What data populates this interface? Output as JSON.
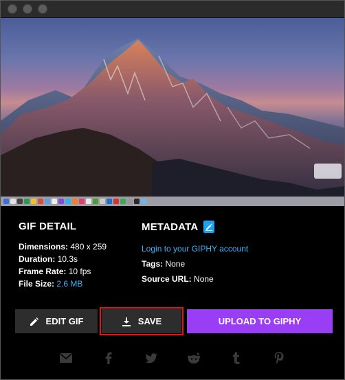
{
  "window": {
    "controls": [
      "close",
      "minimize",
      "zoom"
    ]
  },
  "gif_detail": {
    "title": "GIF DETAIL",
    "dimensions_label": "Dimensions:",
    "dimensions_value": "480 x 259",
    "duration_label": "Duration:",
    "duration_value": "10.3s",
    "frame_rate_label": "Frame Rate:",
    "frame_rate_value": "10 fps",
    "file_size_label": "File Size:",
    "file_size_value": "2.6 MB"
  },
  "metadata": {
    "title": "METADATA",
    "login_link": "Login to your GIPHY account",
    "tags_label": "Tags:",
    "tags_value": "None",
    "source_label": "Source URL:",
    "source_value": "None"
  },
  "buttons": {
    "edit": "EDIT GIF",
    "save": "SAVE",
    "upload": "UPLOAD TO GIPHY"
  },
  "share_icons": [
    "mail-icon",
    "facebook-icon",
    "twitter-icon",
    "reddit-icon",
    "tumblr-icon",
    "pinterest-icon"
  ],
  "colors": {
    "accent_blue": "#3fb3f4",
    "upload_purple": "#9a3ef5",
    "highlight_red": "#e0161a"
  }
}
